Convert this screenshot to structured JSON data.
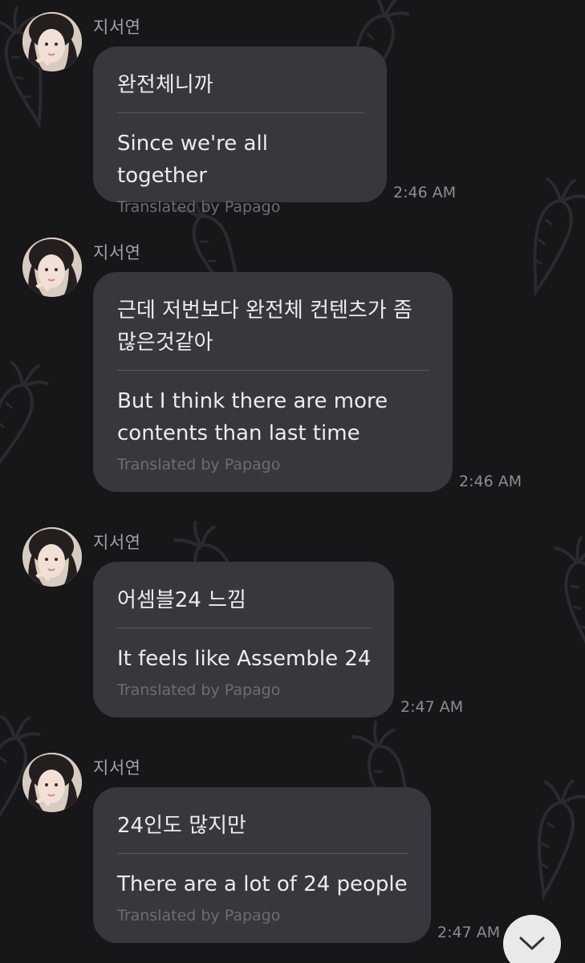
{
  "messages": [
    {
      "sender": "지서연",
      "original": "완전체니까",
      "translation": "Since we're all together",
      "credit": "Translated by Papago",
      "time": "2:46 AM"
    },
    {
      "sender": "지서연",
      "original": "근데 저번보다 완전체 컨텐츠가 좀 많은것같아",
      "translation": "But I think there are more contents than last time",
      "credit": "Translated by Papago",
      "time": "2:46 AM"
    },
    {
      "sender": "지서연",
      "original": "어셈블24 느낌",
      "translation": "It feels like Assemble 24",
      "credit": "Translated by Papago",
      "time": "2:47 AM"
    },
    {
      "sender": "지서연",
      "original": "24인도 많지만",
      "translation": "There are a lot of 24 people",
      "credit": "Translated by Papago",
      "time": "2:47 AM"
    }
  ],
  "icons": {
    "background": "carrot-pattern-icon",
    "scroll": "chevron-down-icon"
  },
  "colors": {
    "background": "#17171a",
    "bubble": "#37383d",
    "text": "#ececee",
    "credit": "#6c6d74",
    "timestamp": "#8c8c92"
  }
}
